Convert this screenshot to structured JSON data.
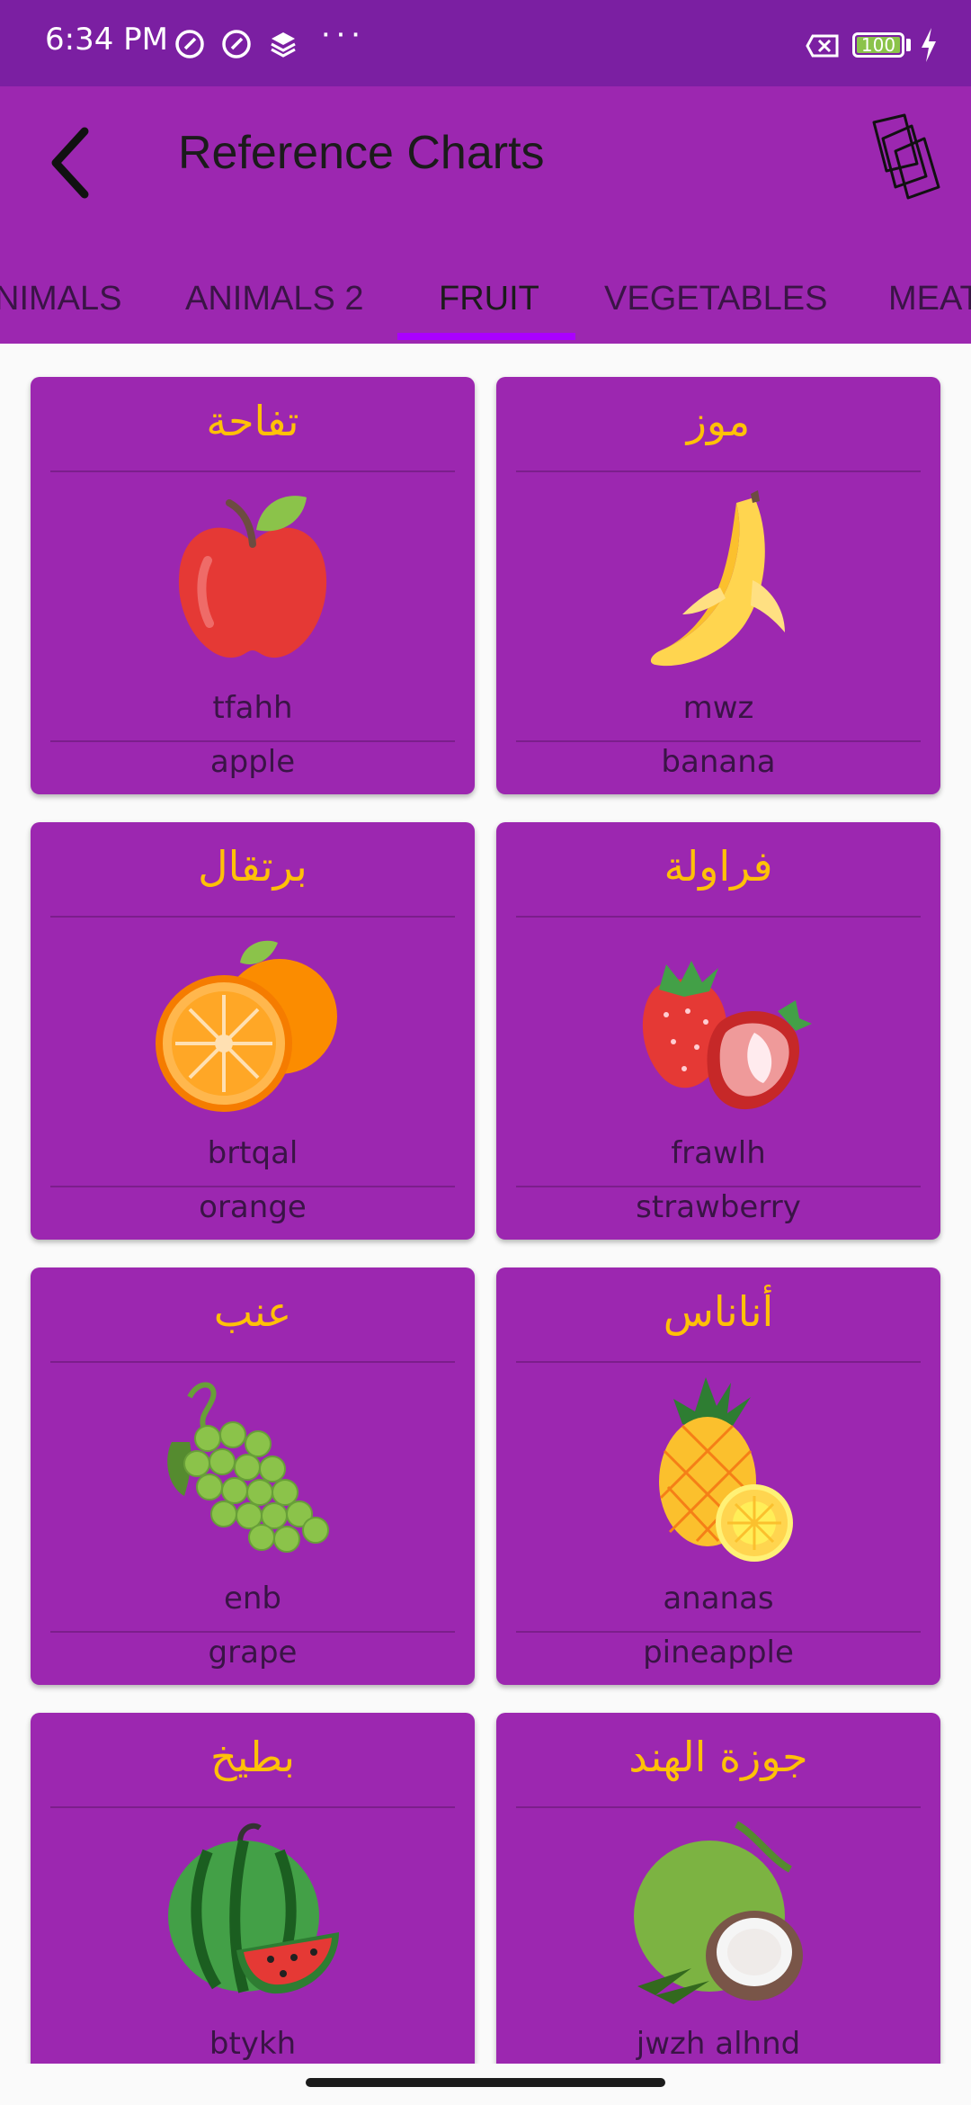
{
  "status_bar": {
    "time": "6:34 PM",
    "dots": "···",
    "battery_percent": 100,
    "battery_label": "100",
    "icons": [
      "silent-icon",
      "silent-icon",
      "layers-icon",
      "sim-off-icon",
      "charging-bolt-icon"
    ]
  },
  "app_bar": {
    "title": "Reference Charts",
    "back_icon": "back-arrow-icon",
    "action_icon": "flashcards-icon"
  },
  "tabs": [
    {
      "label": "NIMALS",
      "active": false
    },
    {
      "label": "ANIMALS 2",
      "active": false
    },
    {
      "label": "FRUIT",
      "active": true
    },
    {
      "label": "VEGETABLES",
      "active": false
    },
    {
      "label": "MEAT",
      "active": false
    }
  ],
  "cards": [
    {
      "arabic": "تفاحة",
      "translit": "tfahh",
      "english": "apple",
      "icon": "apple-icon"
    },
    {
      "arabic": "موز",
      "translit": "mwz",
      "english": "banana",
      "icon": "banana-icon"
    },
    {
      "arabic": "برتقال",
      "translit": "brtqal",
      "english": "orange",
      "icon": "orange-icon"
    },
    {
      "arabic": "فراولة",
      "translit": "frawlh",
      "english": "strawberry",
      "icon": "strawberry-icon"
    },
    {
      "arabic": "عنب",
      "translit": "enb",
      "english": "grape",
      "icon": "grape-icon"
    },
    {
      "arabic": "أناناس",
      "translit": "ananas",
      "english": "pineapple",
      "icon": "pineapple-icon"
    },
    {
      "arabic": "بطيخ",
      "translit": "btykh",
      "english": "",
      "icon": "watermelon-icon"
    },
    {
      "arabic": "جوزة الهند",
      "translit": "jwzh alhnd",
      "english": "",
      "icon": "coconut-icon"
    }
  ],
  "colors": {
    "status_bar": "#7b1fa2",
    "app_bar": "#9c27b0",
    "card": "#9c27b0",
    "arabic_text": "#ffc107",
    "tab_indicator": "#aa00ff"
  }
}
